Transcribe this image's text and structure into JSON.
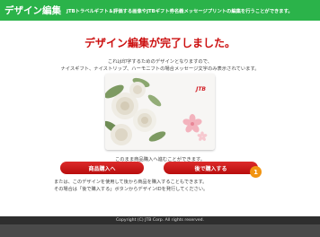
{
  "header": {
    "title": "デザイン編集",
    "description": "JTBトラベルギフト＆評価する画像やJTBギフト券名義メッセージプリントの編集を行うことができます。"
  },
  "main": {
    "title": "デザイン編集が完了しました。",
    "desc_line1": "これは印字するためのデザインとなりますので、",
    "desc_line2": "ナイスギフト、ナイストリップ、ハーモニフトの場合メッセージ文字のみ表示されています。",
    "card_logo": "JTB",
    "instruction": "このまま商品購入へ進むことができます。",
    "buy_button": "商品購入へ",
    "later_button": "後で購入する",
    "badge_number": "1",
    "note_line1": "または、このデザインを使用して後から商品を購入することもできます。",
    "note_line2": "その場合は「後で購入する」ボタンからデザインIDを発行してください。"
  },
  "footer": {
    "copyright": "Copyright (C) JTB Corp. All rights reserved."
  },
  "colors": {
    "header_green": "#2bb34a",
    "title_red": "#cc1010",
    "button_red": "#c41a1a",
    "badge_orange": "#f29410",
    "footer_dark": "#2e2e2e"
  }
}
